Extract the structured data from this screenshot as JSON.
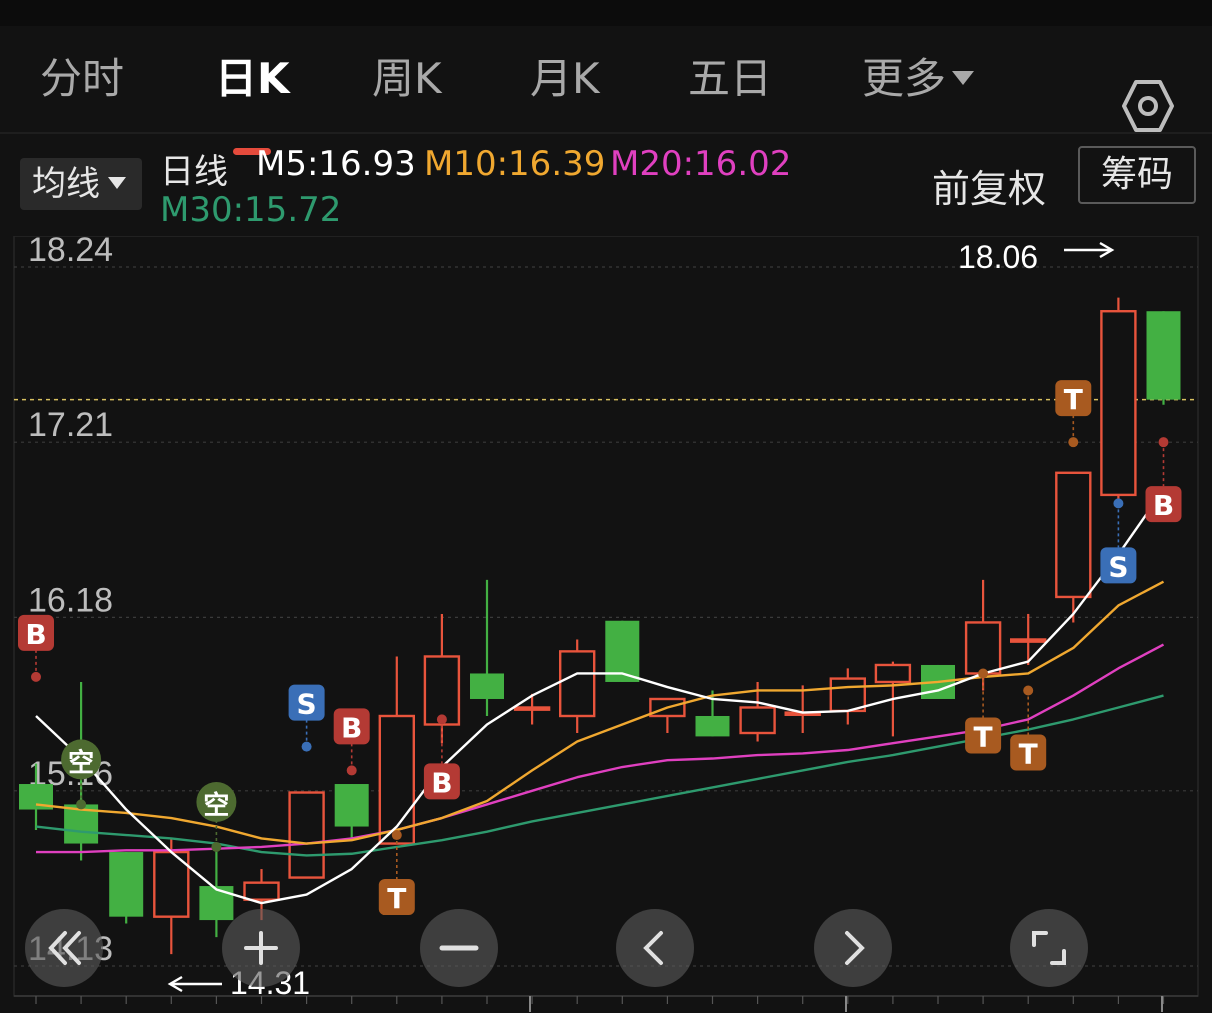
{
  "tabs": [
    {
      "label": "分时"
    },
    {
      "label": "日K",
      "active": true
    },
    {
      "label": "周K"
    },
    {
      "label": "月K"
    },
    {
      "label": "五日"
    },
    {
      "label": "更多"
    }
  ],
  "settings_icon": "hexagon-gear-icon",
  "indicator": {
    "selector_label": "均线",
    "period_label": "日线",
    "ma": [
      {
        "text": "M5:16.93",
        "color": "#ffffff"
      },
      {
        "text": "M10:16.39",
        "color": "#f0a830"
      },
      {
        "text": "M20:16.02",
        "color": "#e040c0"
      },
      {
        "text": "M30:15.72",
        "color": "#2e9a6e"
      }
    ],
    "adjust_label": "前复权",
    "chips_label": "筹码"
  },
  "colors": {
    "up": "#e8543c",
    "down": "#43b043",
    "background": "#121212",
    "grid": "#3a3a3a",
    "current_price_line": "#d8c060"
  },
  "chart_data": {
    "type": "candlestick",
    "y_ticks": [
      "18.24",
      "17.21",
      "16.18",
      "15.16",
      "14.13"
    ],
    "ylim": [
      14.0,
      18.4
    ],
    "max_label": "18.06",
    "min_label": "14.31",
    "current_price": 17.46,
    "candles": [
      {
        "o": 15.2,
        "c": 15.05,
        "h": 15.32,
        "l": 14.93
      },
      {
        "o": 15.08,
        "c": 14.85,
        "h": 15.8,
        "l": 14.75
      },
      {
        "o": 14.8,
        "c": 14.42,
        "h": 14.8,
        "l": 14.38
      },
      {
        "o": 14.42,
        "c": 14.8,
        "h": 14.88,
        "l": 14.2
      },
      {
        "o": 14.6,
        "c": 14.4,
        "h": 14.82,
        "l": 14.3
      },
      {
        "o": 14.52,
        "c": 14.62,
        "h": 14.7,
        "l": 14.4
      },
      {
        "o": 14.65,
        "c": 15.15,
        "h": 15.15,
        "l": 14.65
      },
      {
        "o": 15.2,
        "c": 14.95,
        "h": 15.2,
        "l": 14.87
      },
      {
        "o": 14.85,
        "c": 15.6,
        "h": 15.95,
        "l": 14.85
      },
      {
        "o": 15.55,
        "c": 15.95,
        "h": 16.2,
        "l": 15.44
      },
      {
        "o": 15.85,
        "c": 15.7,
        "h": 16.4,
        "l": 15.6
      },
      {
        "o": 15.65,
        "c": 15.65,
        "h": 15.73,
        "l": 15.55
      },
      {
        "o": 15.6,
        "c": 15.98,
        "h": 16.05,
        "l": 15.5
      },
      {
        "o": 16.16,
        "c": 15.8,
        "h": 16.16,
        "l": 15.8
      },
      {
        "o": 15.6,
        "c": 15.7,
        "h": 15.7,
        "l": 15.5
      },
      {
        "o": 15.6,
        "c": 15.48,
        "h": 15.75,
        "l": 15.48
      },
      {
        "o": 15.5,
        "c": 15.65,
        "h": 15.8,
        "l": 15.45
      },
      {
        "o": 15.62,
        "c": 15.62,
        "h": 15.78,
        "l": 15.5
      },
      {
        "o": 15.63,
        "c": 15.82,
        "h": 15.88,
        "l": 15.55
      },
      {
        "o": 15.8,
        "c": 15.9,
        "h": 15.92,
        "l": 15.48
      },
      {
        "o": 15.9,
        "c": 15.7,
        "h": 15.9,
        "l": 15.7
      },
      {
        "o": 15.85,
        "c": 16.15,
        "h": 16.4,
        "l": 15.75
      },
      {
        "o": 16.05,
        "c": 16.05,
        "h": 16.2,
        "l": 15.9
      },
      {
        "o": 16.3,
        "c": 17.03,
        "h": 17.03,
        "l": 16.15
      },
      {
        "o": 16.9,
        "c": 17.98,
        "h": 18.06,
        "l": 16.85
      },
      {
        "o": 17.98,
        "c": 17.46,
        "h": 17.98,
        "l": 17.43
      }
    ],
    "ma5": [
      15.6,
      15.35,
      15.05,
      14.8,
      14.58,
      14.5,
      14.55,
      14.7,
      14.95,
      15.3,
      15.55,
      15.72,
      15.85,
      15.85,
      15.77,
      15.7,
      15.68,
      15.62,
      15.63,
      15.7,
      15.75,
      15.85,
      15.92,
      16.2,
      16.55,
      16.93
    ],
    "ma10": [
      15.08,
      15.05,
      15.03,
      15.0,
      14.95,
      14.88,
      14.85,
      14.87,
      14.93,
      15.0,
      15.1,
      15.28,
      15.45,
      15.55,
      15.65,
      15.72,
      15.75,
      15.75,
      15.77,
      15.78,
      15.8,
      15.83,
      15.85,
      16.0,
      16.25,
      16.39
    ],
    "ma20": [
      14.8,
      14.8,
      14.81,
      14.81,
      14.82,
      14.83,
      14.85,
      14.88,
      14.93,
      15.0,
      15.08,
      15.16,
      15.24,
      15.3,
      15.34,
      15.35,
      15.37,
      15.38,
      15.4,
      15.44,
      15.48,
      15.52,
      15.58,
      15.72,
      15.88,
      16.02
    ],
    "ma30": [
      14.95,
      14.92,
      14.9,
      14.88,
      14.85,
      14.8,
      14.78,
      14.79,
      14.83,
      14.87,
      14.92,
      14.98,
      15.03,
      15.08,
      15.13,
      15.18,
      15.23,
      15.28,
      15.33,
      15.37,
      15.42,
      15.47,
      15.52,
      15.58,
      15.65,
      15.72
    ],
    "markers": [
      {
        "i": 0,
        "label": "B",
        "color": "#b43a34",
        "price": 15.83,
        "pos": "above"
      },
      {
        "i": 1,
        "label": "空",
        "color": "#4d6a30",
        "price": 15.08,
        "pos": "above"
      },
      {
        "i": 4,
        "label": "空",
        "color": "#4d6a30",
        "price": 14.83,
        "pos": "above"
      },
      {
        "i": 6,
        "label": "S",
        "color": "#3a6fb7",
        "price": 15.42,
        "pos": "above"
      },
      {
        "i": 7,
        "label": "B",
        "color": "#b43a34",
        "price": 15.28,
        "pos": "above"
      },
      {
        "i": 8,
        "label": "T",
        "color": "#a85a20",
        "price": 14.9,
        "pos": "below"
      },
      {
        "i": 9,
        "label": "B",
        "color": "#b43a34",
        "price": 15.58,
        "pos": "below"
      },
      {
        "i": 21,
        "label": "T",
        "color": "#a85a20",
        "price": 15.85,
        "pos": "below"
      },
      {
        "i": 22,
        "label": "T",
        "color": "#a85a20",
        "price": 15.75,
        "pos": "below"
      },
      {
        "i": 23,
        "label": "T",
        "color": "#a85a20",
        "price": 17.21,
        "pos": "above"
      },
      {
        "i": 24,
        "label": "S",
        "color": "#3a6fb7",
        "price": 16.85,
        "pos": "below"
      },
      {
        "i": 25,
        "label": "B",
        "color": "#b43a34",
        "price": 17.21,
        "pos": "below"
      }
    ]
  },
  "controls": [
    {
      "icon": "double-chevron-left-icon"
    },
    {
      "icon": "zoom-in-plus-icon"
    },
    {
      "icon": "zoom-out-minus-icon"
    },
    {
      "icon": "chevron-left-icon"
    },
    {
      "icon": "chevron-right-icon"
    },
    {
      "icon": "fullscreen-icon"
    }
  ]
}
